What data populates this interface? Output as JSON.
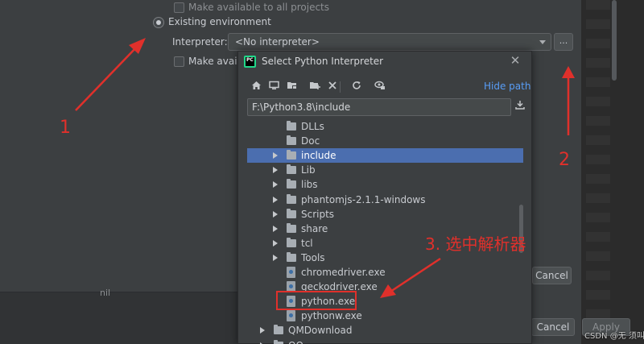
{
  "background": {
    "make_available_top": "Make available to all projects",
    "existing_env_label": "Existing environment",
    "interpreter_label": "Interpreter:",
    "interpreter_value": "<No interpreter>",
    "browse_label": "...",
    "make_available_partial": "Make availal",
    "partial_text": "nil",
    "cancel_mid": "Cancel",
    "cancel_bottom": "Cancel",
    "apply": "Apply"
  },
  "dialog": {
    "title": "Select Python Interpreter",
    "close": "✕",
    "hide_path": "Hide path",
    "path_value": "F:\\Python3.8\\include",
    "toolbar_icons": [
      "home-icon",
      "desktop-icon",
      "project-folder-icon",
      "new-folder-icon",
      "delete-icon",
      "refresh-icon",
      "show-hidden-icon"
    ],
    "tree": [
      {
        "label": "DLLs",
        "type": "folder",
        "expandable": false,
        "level": 2
      },
      {
        "label": "Doc",
        "type": "folder",
        "expandable": false,
        "level": 2
      },
      {
        "label": "include",
        "type": "folder",
        "expandable": true,
        "level": 2,
        "selected": true
      },
      {
        "label": "Lib",
        "type": "folder",
        "expandable": true,
        "level": 2
      },
      {
        "label": "libs",
        "type": "folder",
        "expandable": true,
        "level": 2
      },
      {
        "label": "phantomjs-2.1.1-windows",
        "type": "folder",
        "expandable": true,
        "level": 2
      },
      {
        "label": "Scripts",
        "type": "folder",
        "expandable": true,
        "level": 2
      },
      {
        "label": "share",
        "type": "folder",
        "expandable": true,
        "level": 2
      },
      {
        "label": "tcl",
        "type": "folder",
        "expandable": true,
        "level": 2
      },
      {
        "label": "Tools",
        "type": "folder",
        "expandable": true,
        "level": 2
      },
      {
        "label": "chromedriver.exe",
        "type": "exe",
        "expandable": false,
        "level": 2
      },
      {
        "label": "geckodriver.exe",
        "type": "exe",
        "expandable": false,
        "level": 2
      },
      {
        "label": "python.exe",
        "type": "exe",
        "expandable": false,
        "level": 2
      },
      {
        "label": "pythonw.exe",
        "type": "exe",
        "expandable": false,
        "level": 2
      },
      {
        "label": "QMDownload",
        "type": "folder",
        "expandable": true,
        "level": 1
      },
      {
        "label": "QQ",
        "type": "folder",
        "expandable": true,
        "level": 1
      }
    ]
  },
  "annotations": {
    "n1": "1",
    "n2": "2",
    "n3": "3. 选中解析器",
    "color": "#e0302b"
  },
  "watermark": "CSDN @无 须叫"
}
